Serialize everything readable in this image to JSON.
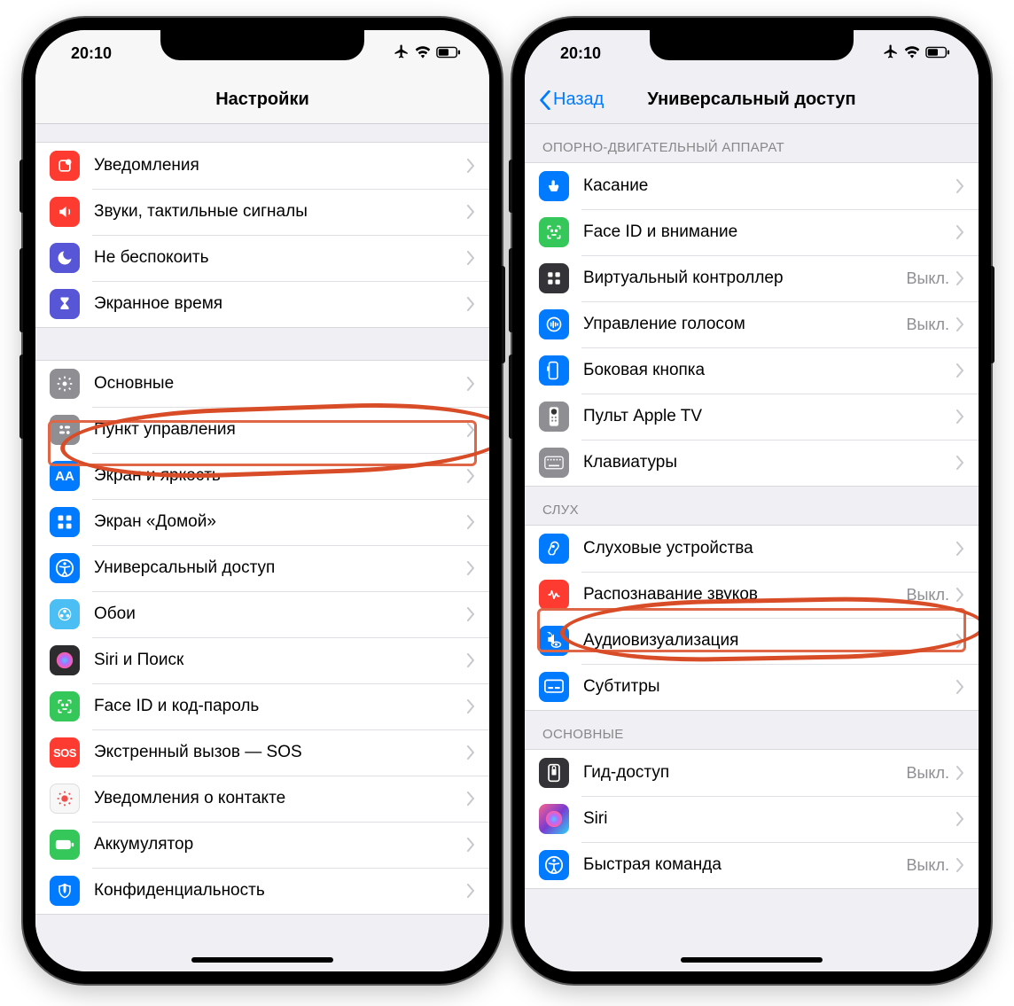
{
  "status": {
    "time": "20:10"
  },
  "left": {
    "title": "Настройки",
    "group1": [
      {
        "label": "Уведомления",
        "icon": "notifications-icon",
        "bg": "ic-red"
      },
      {
        "label": "Звуки, тактильные сигналы",
        "icon": "sounds-icon",
        "bg": "ic-pink"
      },
      {
        "label": "Не беспокоить",
        "icon": "dnd-icon",
        "bg": "ic-purple"
      },
      {
        "label": "Экранное время",
        "icon": "screentime-icon",
        "bg": "ic-hour"
      }
    ],
    "group2": [
      {
        "label": "Основные",
        "icon": "general-icon",
        "bg": "ic-gray"
      },
      {
        "label": "Пункт управления",
        "icon": "control-center-icon",
        "bg": "ic-gray"
      },
      {
        "label": "Экран и яркость",
        "icon": "display-icon",
        "bg": "ic-blue"
      },
      {
        "label": "Экран «Домой»",
        "icon": "home-screen-icon",
        "bg": "ic-blue"
      },
      {
        "label": "Универсальный доступ",
        "icon": "accessibility-icon",
        "bg": "ic-blue",
        "highlight": true
      },
      {
        "label": "Обои",
        "icon": "wallpaper-icon",
        "bg": "ic-cyan"
      },
      {
        "label": "Siri и Поиск",
        "icon": "siri-icon",
        "bg": "ic-black"
      },
      {
        "label": "Face ID и код-пароль",
        "icon": "faceid-icon",
        "bg": "ic-green"
      },
      {
        "label": "Экстренный вызов — SOS",
        "icon": "sos-icon",
        "bg": "ic-sos"
      },
      {
        "label": "Уведомления о контакте",
        "icon": "exposure-icon",
        "bg": "ic-white"
      },
      {
        "label": "Аккумулятор",
        "icon": "battery-icon",
        "bg": "ic-green"
      },
      {
        "label": "Конфиденциальность",
        "icon": "privacy-icon",
        "bg": "ic-blue"
      }
    ]
  },
  "right": {
    "back": "Назад",
    "title": "Универсальный доступ",
    "section1_header": "ОПОРНО-ДВИГАТЕЛЬНЫЙ АППАРАТ",
    "group1": [
      {
        "label": "Касание",
        "icon": "touch-icon",
        "bg": "ic-blue",
        "value": ""
      },
      {
        "label": "Face ID и внимание",
        "icon": "faceid-attn-icon",
        "bg": "ic-green",
        "value": ""
      },
      {
        "label": "Виртуальный контроллер",
        "icon": "switch-control-icon",
        "bg": "ic-dark",
        "value": "Выкл."
      },
      {
        "label": "Управление голосом",
        "icon": "voice-control-icon",
        "bg": "ic-blue",
        "value": "Выкл."
      },
      {
        "label": "Боковая кнопка",
        "icon": "side-button-icon",
        "bg": "ic-blue",
        "value": ""
      },
      {
        "label": "Пульт Apple TV",
        "icon": "apple-tv-icon",
        "bg": "ic-gray",
        "value": ""
      },
      {
        "label": "Клавиатуры",
        "icon": "keyboard-icon",
        "bg": "ic-gray",
        "value": ""
      }
    ],
    "section2_header": "СЛУХ",
    "group2": [
      {
        "label": "Слуховые устройства",
        "icon": "hearing-icon",
        "bg": "ic-blue",
        "value": ""
      },
      {
        "label": "Распознавание звуков",
        "icon": "sound-recognition-icon",
        "bg": "ic-red",
        "value": "Выкл."
      },
      {
        "label": "Аудиовизуализация",
        "icon": "audio-visual-icon",
        "bg": "ic-blue",
        "value": "",
        "highlight": true
      },
      {
        "label": "Субтитры",
        "icon": "subtitles-icon",
        "bg": "ic-blue",
        "value": ""
      }
    ],
    "section3_header": "ОСНОВНЫЕ",
    "group3": [
      {
        "label": "Гид-доступ",
        "icon": "guided-access-icon",
        "bg": "ic-dark",
        "value": "Выкл."
      },
      {
        "label": "Siri",
        "icon": "siri-icon",
        "bg": "ic-grad2",
        "value": ""
      },
      {
        "label": "Быстрая команда",
        "icon": "shortcut-icon",
        "bg": "ic-blue",
        "value": "Выкл."
      }
    ]
  }
}
